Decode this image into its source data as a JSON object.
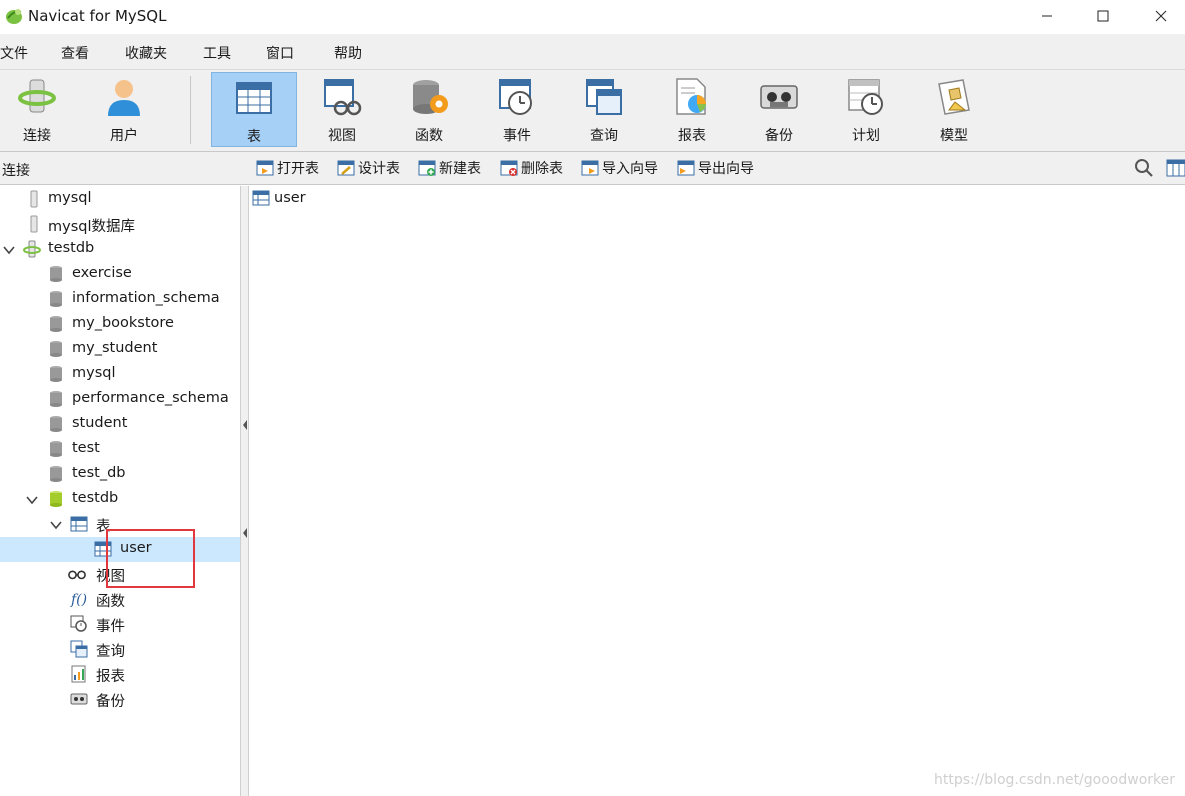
{
  "window": {
    "title": "Navicat for MySQL"
  },
  "menu": [
    "文件",
    "查看",
    "收藏夹",
    "工具",
    "窗口",
    "帮助"
  ],
  "toolbar": [
    {
      "label": "连接",
      "icon": "connection-icon"
    },
    {
      "label": "用户",
      "icon": "user-icon"
    },
    {
      "label": "表",
      "icon": "table-icon",
      "active": true
    },
    {
      "label": "视图",
      "icon": "view-icon"
    },
    {
      "label": "函数",
      "icon": "function-icon"
    },
    {
      "label": "事件",
      "icon": "event-icon"
    },
    {
      "label": "查询",
      "icon": "query-icon"
    },
    {
      "label": "报表",
      "icon": "report-icon"
    },
    {
      "label": "备份",
      "icon": "backup-icon"
    },
    {
      "label": "计划",
      "icon": "schedule-icon"
    },
    {
      "label": "模型",
      "icon": "model-icon"
    }
  ],
  "object_bar": {
    "connection_header": "连接",
    "actions": [
      "打开表",
      "设计表",
      "新建表",
      "删除表",
      "导入向导",
      "导出向导"
    ]
  },
  "tree": [
    {
      "label": "mysql",
      "type": "connection-closed"
    },
    {
      "label": "mysql数据库",
      "type": "connection-closed"
    },
    {
      "label": "testdb",
      "type": "connection-open"
    },
    {
      "label": "exercise",
      "type": "database"
    },
    {
      "label": "information_schema",
      "type": "database"
    },
    {
      "label": "my_bookstore",
      "type": "database"
    },
    {
      "label": "my_student",
      "type": "database"
    },
    {
      "label": "mysql",
      "type": "database"
    },
    {
      "label": "performance_schema",
      "type": "database"
    },
    {
      "label": "student",
      "type": "database"
    },
    {
      "label": "test",
      "type": "database"
    },
    {
      "label": "test_db",
      "type": "database"
    },
    {
      "label": "testdb",
      "type": "database-open"
    },
    {
      "label": "表",
      "type": "tables"
    },
    {
      "label": "user",
      "type": "table",
      "selected": true
    },
    {
      "label": "视图",
      "type": "views"
    },
    {
      "label": "函数",
      "type": "functions"
    },
    {
      "label": "事件",
      "type": "events"
    },
    {
      "label": "查询",
      "type": "queries"
    },
    {
      "label": "报表",
      "type": "reports"
    },
    {
      "label": "备份",
      "type": "backups"
    }
  ],
  "content": {
    "items": [
      "user"
    ]
  },
  "watermark": "https://blog.csdn.net/gooodworker",
  "colors": {
    "selection": "#cce8ff",
    "active_tool": "#a6d0f5",
    "annotation_box": "#e0383e"
  }
}
